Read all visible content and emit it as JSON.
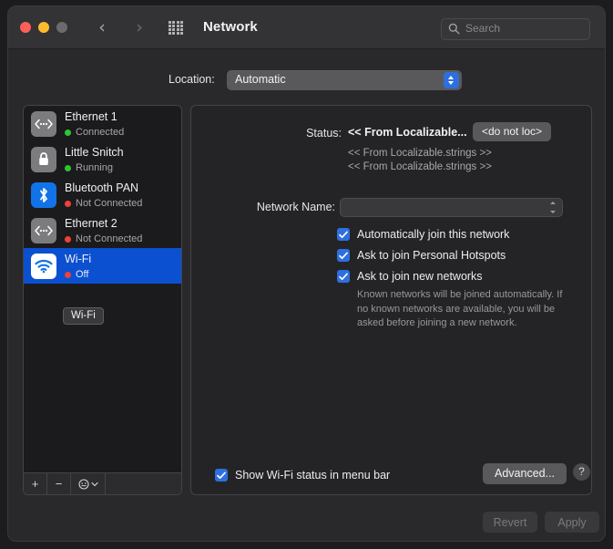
{
  "window": {
    "title": "Network",
    "traffic_lights": [
      "close",
      "minimize",
      "zoom"
    ],
    "nav_back": "‹",
    "nav_forward": "›",
    "grid_icon": "grid-view-icon",
    "search": {
      "placeholder": "Search",
      "value": "",
      "icon": "search-icon"
    }
  },
  "location": {
    "label": "Location:",
    "value": "Automatic"
  },
  "sidebar": {
    "services": [
      {
        "name": "Ethernet 1",
        "status": "Connected",
        "dot": "green",
        "icon": "ethernet-icon",
        "selected": false
      },
      {
        "name": "Little Snitch",
        "status": "Running",
        "dot": "green",
        "icon": "lock-icon",
        "selected": false
      },
      {
        "name": "Bluetooth PAN",
        "status": "Not Connected",
        "dot": "red",
        "icon": "bluetooth-icon",
        "selected": false
      },
      {
        "name": "Ethernet 2",
        "status": "Not Connected",
        "dot": "red",
        "icon": "ethernet-icon",
        "selected": false
      },
      {
        "name": "Wi-Fi",
        "status": "Off",
        "dot": "red",
        "icon": "wifi-icon",
        "selected": true
      }
    ],
    "tooltip": "Wi-Fi",
    "footer": {
      "add": "+",
      "remove": "−",
      "actions_icon": "action-menu-icon",
      "actions_chevron": "chevron-down-icon"
    }
  },
  "panel": {
    "status_label": "Status:",
    "status_value": "<< From Localizable...",
    "status_button": "<do not loc>",
    "status_line_1": "<< From Localizable.strings >>",
    "status_line_2": "<< From Localizable.strings >>",
    "network_name_label": "Network Name:",
    "network_name_value": "",
    "checkboxes": [
      {
        "label": "Automatically join this network",
        "checked": true
      },
      {
        "label": "Ask to join Personal Hotspots",
        "checked": true
      },
      {
        "label": "Ask to join new networks",
        "checked": true
      }
    ],
    "helper_text": "Known networks will be joined automatically. If no known networks are available, you will be asked before joining a new network.",
    "menubar_checkbox": {
      "label": "Show Wi-Fi status in menu bar",
      "checked": true
    },
    "advanced_button": "Advanced...",
    "help_button": "?"
  },
  "footer": {
    "revert": "Revert",
    "apply": "Apply"
  },
  "colors": {
    "selection_blue": "#0b50d0",
    "accent_blue": "#2e6fe0",
    "status_green": "#2fc62f",
    "status_red": "#ef4136",
    "window_bg": "#29292b",
    "panel_bg": "#242426"
  }
}
